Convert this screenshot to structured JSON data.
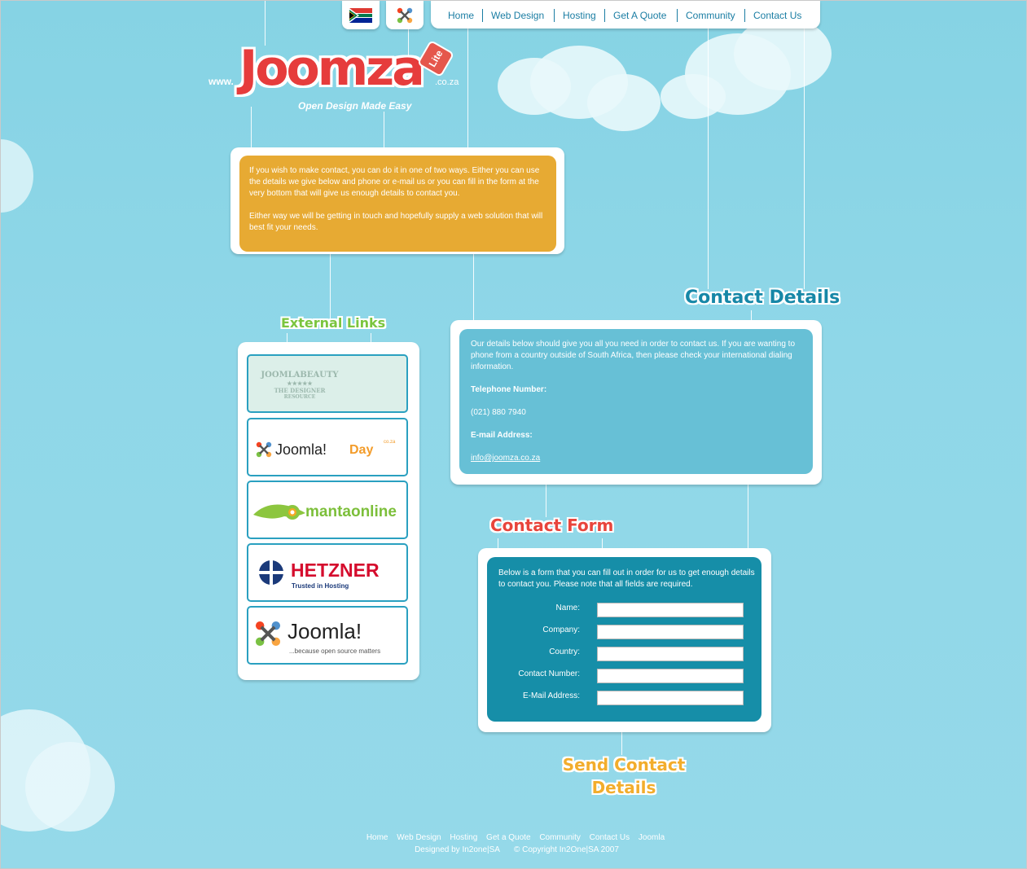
{
  "nav": {
    "items": [
      "Home",
      "Web Design",
      "Hosting",
      "Get A Quote",
      "Community",
      "Contact Us"
    ]
  },
  "logo": {
    "www": "www.",
    "brand": "Joomza",
    "tld": ".co.za",
    "tag": "Lite",
    "tagline": "Open Design Made Easy"
  },
  "intro": {
    "p1": "If you wish to make contact, you can do it in one of two ways. Either you can use the details we give below and phone or e-mail us or you can fill in the form at the very bottom that will give us enough details to contact you.",
    "p2": "Either way we will be getting in touch and hopefully supply a web solution that will best fit your needs."
  },
  "external": {
    "heading": "External Links",
    "links": [
      {
        "name": "joomlabeauty",
        "line1": "JOOMLABEAUTY",
        "line2": "★★★★★",
        "line3": "THE DESIGNER",
        "line4": "RESOURCE"
      },
      {
        "name": "joomla-day",
        "text": "Joomla!",
        "text2": "Day",
        "text3": "co.za"
      },
      {
        "name": "mantaonline",
        "text": "mantaonline"
      },
      {
        "name": "hetzner",
        "text": "HETZNER",
        "text2": "Trusted in Hosting"
      },
      {
        "name": "joomla",
        "text": "Joomla!",
        "text2": "...because open source matters"
      }
    ]
  },
  "contact_details": {
    "heading": "Contact Details",
    "intro": "Our details below should give you all you need in order to contact us. If you are wanting to phone from a country outside of South Africa, then please check your international dialing information.",
    "phone_label": "Telephone Number:",
    "phone": "(021) 880 7940",
    "email_label": "E-mail Address:",
    "email": "info@joomza.co.za"
  },
  "contact_form": {
    "heading": "Contact Form",
    "intro": "Below is a form that you can fill out in order for us to get enough details to contact you. Please note that all fields are required.",
    "fields": [
      "Name:",
      "Company:",
      "Country:",
      "Contact Number:",
      "E-Mail Address:"
    ],
    "submit_line1": "Send Contact",
    "submit_line2": "Details"
  },
  "footer": {
    "links": [
      "Home",
      "Web Design",
      "Hosting",
      "Get a Quote",
      "Community",
      "Contact Us",
      "Joomla"
    ],
    "designed": "Designed by In2one|SA",
    "copyright": "© Copyright In2One|SA 2007"
  },
  "colors": {
    "sky": "#8fd6e6",
    "orange": "#e7aa33",
    "details": "#67c0d6",
    "form": "#168ea8",
    "nav_text": "#1a7da3"
  }
}
